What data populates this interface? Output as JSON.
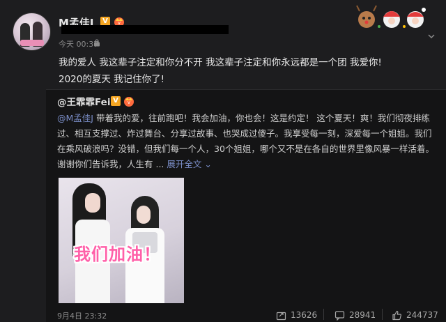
{
  "post": {
    "username": "M孟佳J",
    "time": "今天 00:37",
    "text_line1": "我的爱人 我这辈子注定和你分不开 我这辈子注定和你永远都是一个团 我爱你!",
    "text_line2": "2020的夏天 我记住你了!"
  },
  "repost": {
    "username": "@王霏霏Fei",
    "mention": "@M孟佳J",
    "text": " 带着我的爱，往前跑吧！我会加油，你也会！这是约定！ 这个夏天！爽！我们彻夜排练过、相互支撑过、炸过舞台、分享过故事、也哭成过傻子。我享受每一刻，深爱每一个姐姐。我们在乘风破浪吗？没错，但我们每一个人，30个姐姐，哪个又不是在各自的世界里像风暴一样活着。谢谢你们告诉我，人生有 ...",
    "expand_label": "展开全文",
    "photo_caption": "我们加油！",
    "time": "9月4日 23:32",
    "reposts": "13626",
    "comments": "28941",
    "likes": "244737"
  },
  "colors": {
    "background": "#1d1d1f",
    "repost_background": "#141415",
    "link": "#7a8dc7",
    "badge": "#f5a623",
    "caption_pink": "#ff5fa8"
  }
}
